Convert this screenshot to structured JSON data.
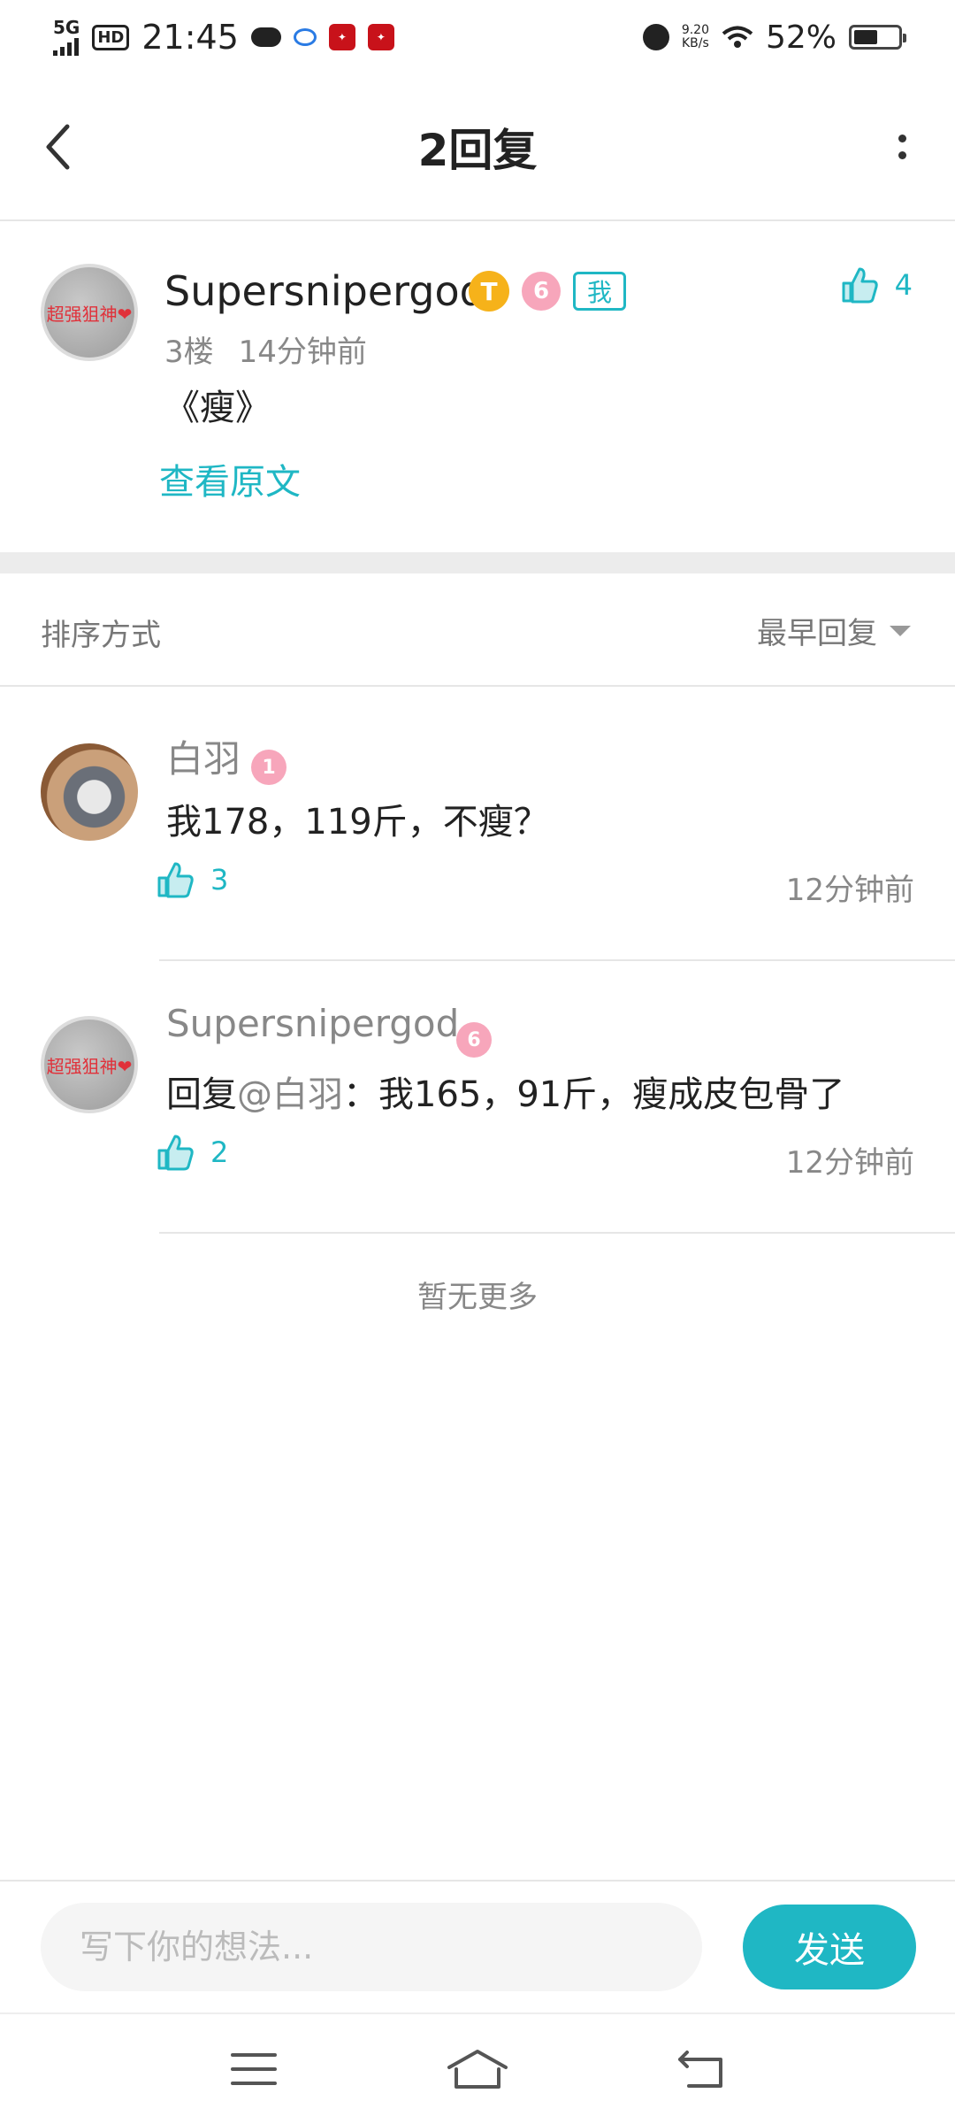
{
  "status_bar": {
    "network": "5G",
    "hd": "HD",
    "time": "21:45",
    "net_speed_value": "9.20",
    "net_speed_unit": "KB/s",
    "battery": "52%"
  },
  "header": {
    "title": "2回复"
  },
  "original_post": {
    "avatar_text": "超强狙神❤",
    "username": "Supersnipergod",
    "badge_t": "T",
    "badge_level": "6",
    "badge_me": "我",
    "likes": "4",
    "floor": "3楼",
    "time": "14分钟前",
    "text": "《瘦》",
    "view_original": "查看原文"
  },
  "sort": {
    "label": "排序方式",
    "selected": "最早回复"
  },
  "replies": [
    {
      "username": "白羽",
      "badge_level": "1",
      "text": "我178，119斤，不瘦？",
      "likes": "3",
      "time": "12分钟前"
    },
    {
      "avatar_text": "超强狙神❤",
      "username": "Supersnipergod",
      "badge_level": "6",
      "reply_prefix": "回复",
      "mention": "@白羽",
      "text": "：我165，91斤，瘦成皮包骨了",
      "likes": "2",
      "time": "12分钟前"
    }
  ],
  "footer_note": "暂无更多",
  "input": {
    "placeholder": "写下你的想法...",
    "send_label": "发送"
  },
  "colors": {
    "accent": "#1fb7c4",
    "level_badge": "#f7a6bb",
    "gold_badge": "#f6b21a"
  }
}
